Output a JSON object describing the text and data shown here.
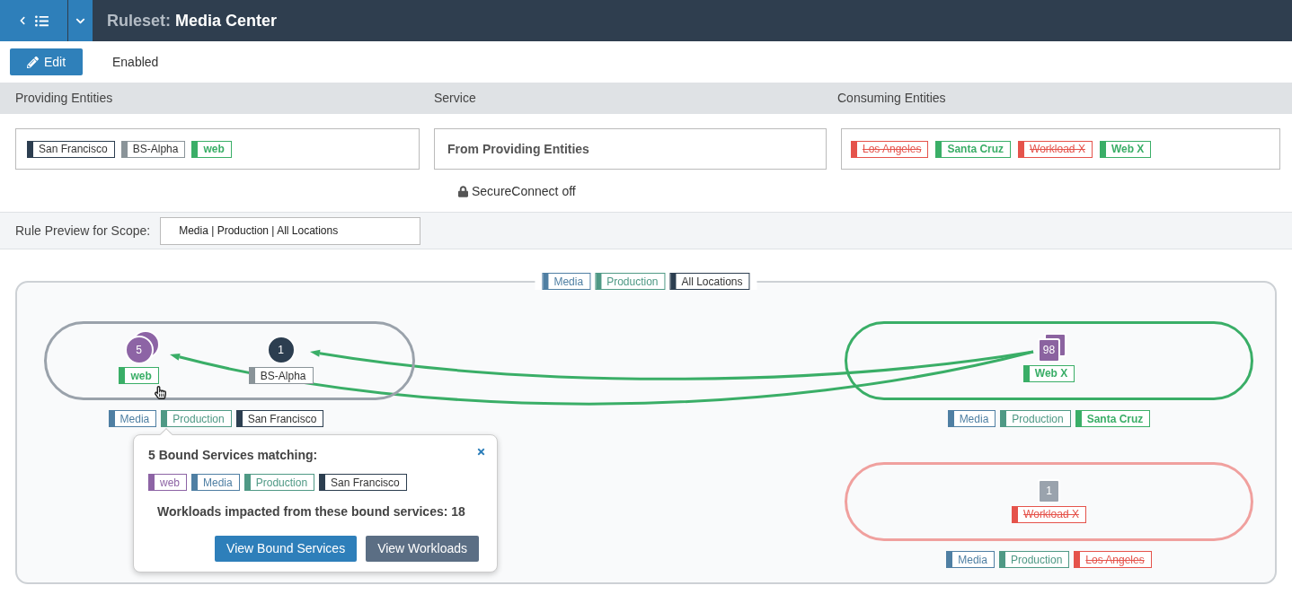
{
  "header": {
    "title_prefix": "Ruleset:",
    "title": "Media Center"
  },
  "toolbar": {
    "edit_button": "Edit",
    "status": "Enabled"
  },
  "providing_entities": {
    "heading": "Providing Entities",
    "labels": [
      {
        "text": "San Francisco",
        "color": "#2c3e50",
        "kind": "plain"
      },
      {
        "text": "BS-Alpha",
        "color": "#8a9499",
        "kind": "plain"
      },
      {
        "text": "web",
        "color": "#3aae67",
        "kind": "added"
      }
    ]
  },
  "service": {
    "heading": "Service",
    "value": "From Providing Entities",
    "secure_connect": "SecureConnect off"
  },
  "consuming_entities": {
    "heading": "Consuming Entities",
    "labels": [
      {
        "text": "Los Angeles",
        "color": "#e5534b",
        "kind": "removed"
      },
      {
        "text": "Santa Cruz",
        "color": "#3aae67",
        "kind": "added"
      },
      {
        "text": "Workload X",
        "color": "#e5534b",
        "kind": "removed"
      },
      {
        "text": "Web X",
        "color": "#3aae67",
        "kind": "added"
      }
    ]
  },
  "scope": {
    "label": "Rule Preview for Scope:",
    "value": "Media | Production | All Locations"
  },
  "diagram": {
    "scope_labels": [
      {
        "text": "Media",
        "color": "#4f7fa3",
        "kind": "tinted"
      },
      {
        "text": "Production",
        "color": "#4f9985",
        "kind": "tinted"
      },
      {
        "text": "All Locations",
        "color": "#2c3e50",
        "kind": "plain"
      }
    ],
    "groups": [
      {
        "kind": "unchanged",
        "nodes": [
          {
            "count": "5",
            "kind": "circle",
            "color": "#8d64a5",
            "stacked": true,
            "label": {
              "text": "web",
              "color": "#3aae67",
              "kind": "added"
            }
          },
          {
            "count": "1",
            "kind": "circle",
            "color": "#2c3e50",
            "stacked": false,
            "label": {
              "text": "BS-Alpha",
              "color": "#8a9499",
              "kind": "plain"
            }
          }
        ],
        "labels": [
          {
            "text": "Media",
            "color": "#4f7fa3",
            "kind": "tinted"
          },
          {
            "text": "Production",
            "color": "#4f9985",
            "kind": "tinted"
          },
          {
            "text": "San Francisco",
            "color": "#2c3e50",
            "kind": "plain"
          }
        ]
      },
      {
        "kind": "added",
        "nodes": [
          {
            "count": "98",
            "kind": "square",
            "color": "#8b63a0",
            "stacked": true,
            "label": {
              "text": "Web X",
              "color": "#3aae67",
              "kind": "added"
            }
          }
        ],
        "labels": [
          {
            "text": "Media",
            "color": "#4f7fa3",
            "kind": "tinted"
          },
          {
            "text": "Production",
            "color": "#4f9985",
            "kind": "tinted"
          },
          {
            "text": "Santa Cruz",
            "color": "#3aae67",
            "kind": "added"
          }
        ]
      },
      {
        "kind": "removed",
        "nodes": [
          {
            "count": "1",
            "kind": "square",
            "color": "#9aa3ad",
            "stacked": false,
            "label": {
              "text": "Workload X",
              "color": "#e5534b",
              "kind": "removed"
            }
          }
        ],
        "labels": [
          {
            "text": "Media",
            "color": "#4f7fa3",
            "kind": "tinted"
          },
          {
            "text": "Production",
            "color": "#4f9985",
            "kind": "tinted"
          },
          {
            "text": "Los Angeles",
            "color": "#e5534b",
            "kind": "removed"
          }
        ]
      }
    ],
    "popup": {
      "title": "5 Bound Services matching:",
      "labels": [
        {
          "text": "web",
          "color": "#8d64a5",
          "kind": "tinted"
        },
        {
          "text": "Media",
          "color": "#4f7fa3",
          "kind": "tinted"
        },
        {
          "text": "Production",
          "color": "#4f9985",
          "kind": "tinted"
        },
        {
          "text": "San Francisco",
          "color": "#2c3e50",
          "kind": "plain"
        }
      ],
      "summary": "Workloads impacted from these bound services: 18",
      "buttons": [
        {
          "text": "View Bound Services",
          "kind": "primary"
        },
        {
          "text": "View Workloads",
          "kind": "secondary"
        }
      ]
    }
  }
}
